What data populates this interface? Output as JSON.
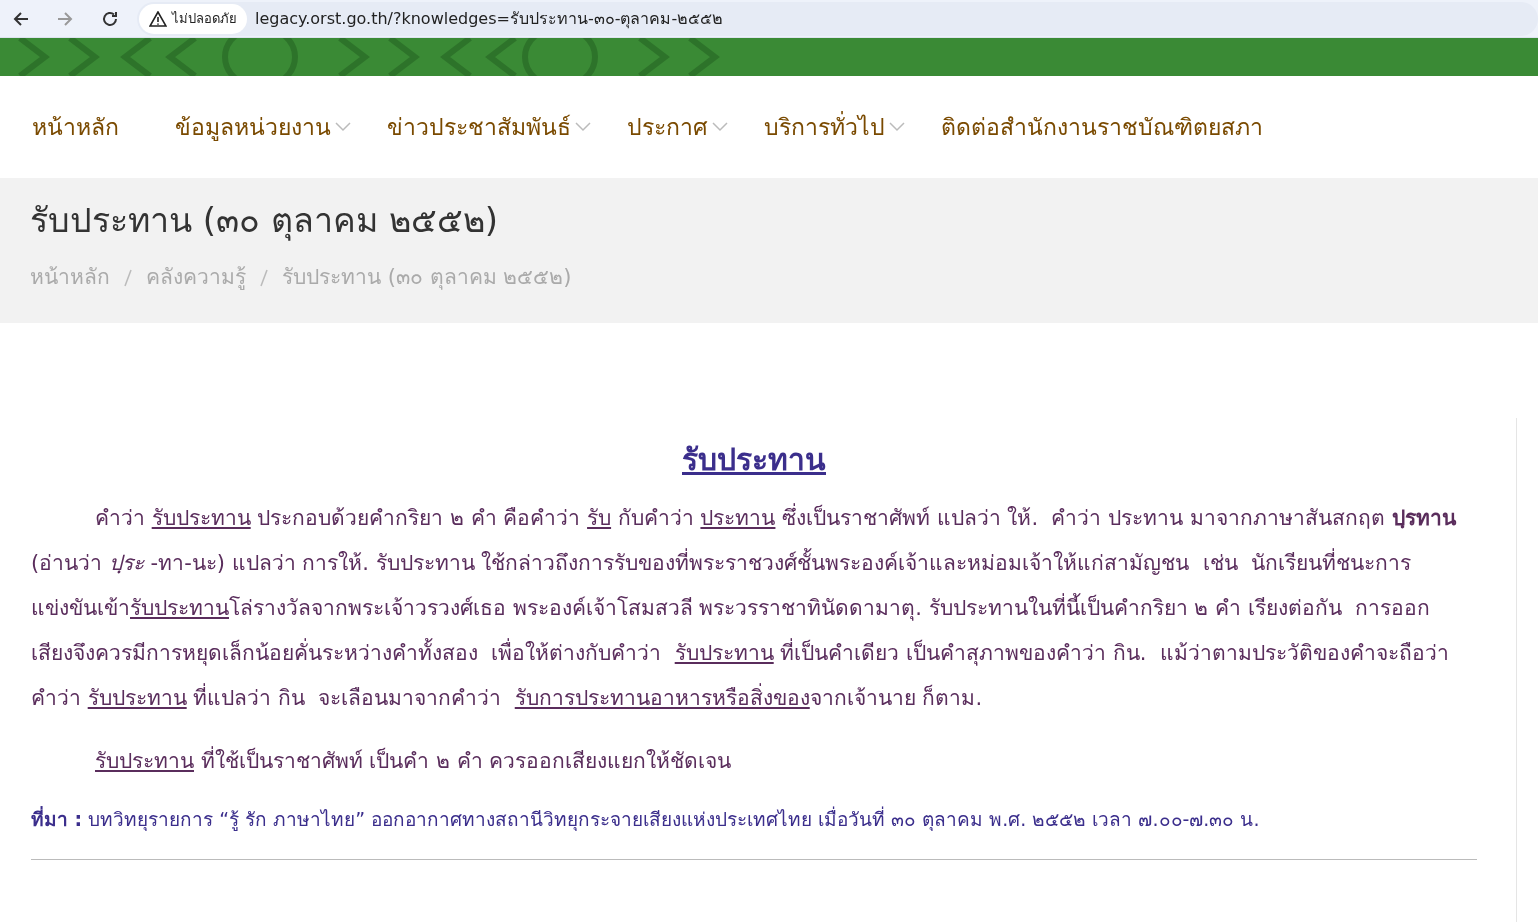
{
  "browser": {
    "security_label": "ไม่ปลอดภัย",
    "url": "legacy.orst.go.th/?knowledges=รับประทาน-๓๐-ตุลาคม-๒๕๕๒"
  },
  "nav": [
    {
      "label": "หน้าหลัก",
      "dropdown": false
    },
    {
      "label": "ข้อมูลหน่วยงาน",
      "dropdown": true
    },
    {
      "label": "ข่าวประชาสัมพันธ์",
      "dropdown": true
    },
    {
      "label": "ประกาศ",
      "dropdown": true
    },
    {
      "label": "บริการทั่วไป",
      "dropdown": true
    },
    {
      "label": "ติดต่อสำนักงานราชบัณฑิตยสภา",
      "dropdown": false
    }
  ],
  "page_title": "รับประทาน (๓๐ ตุลาคม ๒๕๕๒)",
  "breadcrumbs": [
    "หน้าหลัก",
    "คลังความรู้",
    "รับประทาน (๓๐ ตุลาคม ๒๕๕๒)"
  ],
  "article": {
    "heading": "รับประทาน",
    "paragraphs": [
      [
        {
          "kind": "plain",
          "text": "คำว่า "
        },
        {
          "kind": "underline",
          "text": "รับประทาน"
        },
        {
          "kind": "plain",
          "text": " ประกอบด้วยคำกริยา ๒ คำ คือคำว่า "
        },
        {
          "kind": "underline",
          "text": "รับ"
        },
        {
          "kind": "plain",
          "text": " กับคำว่า "
        },
        {
          "kind": "underline",
          "text": "ประทาน"
        },
        {
          "kind": "plain",
          "text": " ซึ่งเป็นราชาศัพท์ แปลว่า ให้.  คำว่า ประทาน มาจากภาษาสันสกฤต "
        },
        {
          "kind": "bold",
          "text": "ปฺรทาน"
        },
        {
          "kind": "plain",
          "text": " (อ่านว่า "
        },
        {
          "kind": "italic",
          "text": "ปฺระ"
        },
        {
          "kind": "plain",
          "text": " -ทา-นะ) แปลว่า การให้. รับประทาน ใช้กล่าวถึงการรับของที่พระราชวงศ์ชั้นพระองค์เจ้าและหม่อมเจ้าให้แก่สามัญชน  เช่น  นักเรียนที่ชนะการแข่งขันเข้า"
        },
        {
          "kind": "underline",
          "text": "รับประทาน"
        },
        {
          "kind": "plain",
          "text": "โล่รางวัลจากพระเจ้าวรวงศ์เธอ พระองค์เจ้าโสมสวลี พระวรราชาทินัดดามาตุ. รับประทานในที่นี้เป็นคำกริยา ๒ คำ เรียงต่อกัน  การออกเสียงจึงควรมีการหยุดเล็กน้อยคั่นระหว่างคำทั้งสอง  เพื่อให้ต่างกับคำว่า  "
        },
        {
          "kind": "underline",
          "text": "รับประทาน"
        },
        {
          "kind": "plain",
          "text": " ที่เป็นคำเดียว เป็นคำสุภาพของคำว่า กิน.  แม้ว่าตามประวัติของคำจะถือว่า  คำว่า "
        },
        {
          "kind": "underline",
          "text": "รับประทาน"
        },
        {
          "kind": "plain",
          "text": " ที่แปลว่า กิน  จะเลือนมาจากคำว่า  "
        },
        {
          "kind": "underline",
          "text": "รับการประทานอาหารหรือสิ่งของ"
        },
        {
          "kind": "plain",
          "text": "จากเจ้านาย ก็ตาม."
        }
      ],
      [
        {
          "kind": "underline",
          "text": "รับประทาน"
        },
        {
          "kind": "plain",
          "text": " ที่ใช้เป็นราชาศัพท์ เป็นคำ ๒ คำ ควรออกเสียงแยกให้ชัดเจน"
        }
      ]
    ],
    "source_label": "ที่มา :",
    "source_text": "บทวิทยุรายการ “รู้ รัก ภาษาไทย” ออกอากาศทางสถานีวิทยุกระจายเสียงแห่งประเทศไทย เมื่อวันที่ ๓๐ ตุลาคม พ.ศ. ๒๕๕๒ เวลา ๗.๐๐-๗.๓๐ น."
  }
}
